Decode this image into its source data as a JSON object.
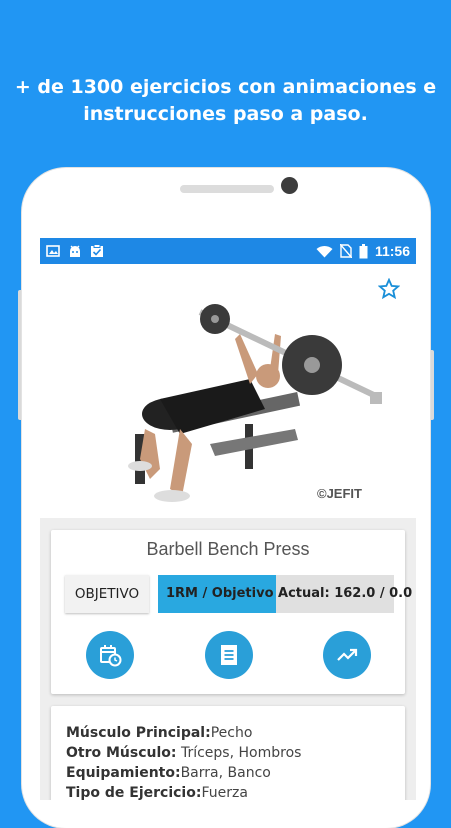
{
  "promo": {
    "line1": "+ de 1300 ejercicios con animaciones e",
    "line2": "instrucciones paso a paso."
  },
  "statusbar": {
    "time": "11:56",
    "icons": [
      "image-icon",
      "android-icon",
      "clipboard-check-icon",
      "wifi-icon",
      "no-sim-icon",
      "battery-icon"
    ]
  },
  "image": {
    "watermark": "©JEFIT"
  },
  "exercise": {
    "name": "Barbell Bench Press",
    "objective_label": "OBJETIVO",
    "progress_text": "1RM / Objetivo Actual: 162.0 / 0.0",
    "progress_fraction": 0.5
  },
  "actions": [
    "calendar-clock-icon",
    "log-list-icon",
    "trending-up-icon"
  ],
  "details": {
    "primary_label": "Músculo Principal:",
    "primary_value": "Pecho",
    "secondary_label": "Otro Músculo:",
    "secondary_value": " Tríceps, Hombros",
    "equipment_label": "Equipamiento:",
    "equipment_value": "Barra, Banco",
    "type_label": "Tipo de Ejercicio:",
    "type_value": "Fuerza"
  },
  "colors": {
    "background": "#2196f3",
    "statusbar": "#1e88e5",
    "accent": "#2a9fd8"
  }
}
